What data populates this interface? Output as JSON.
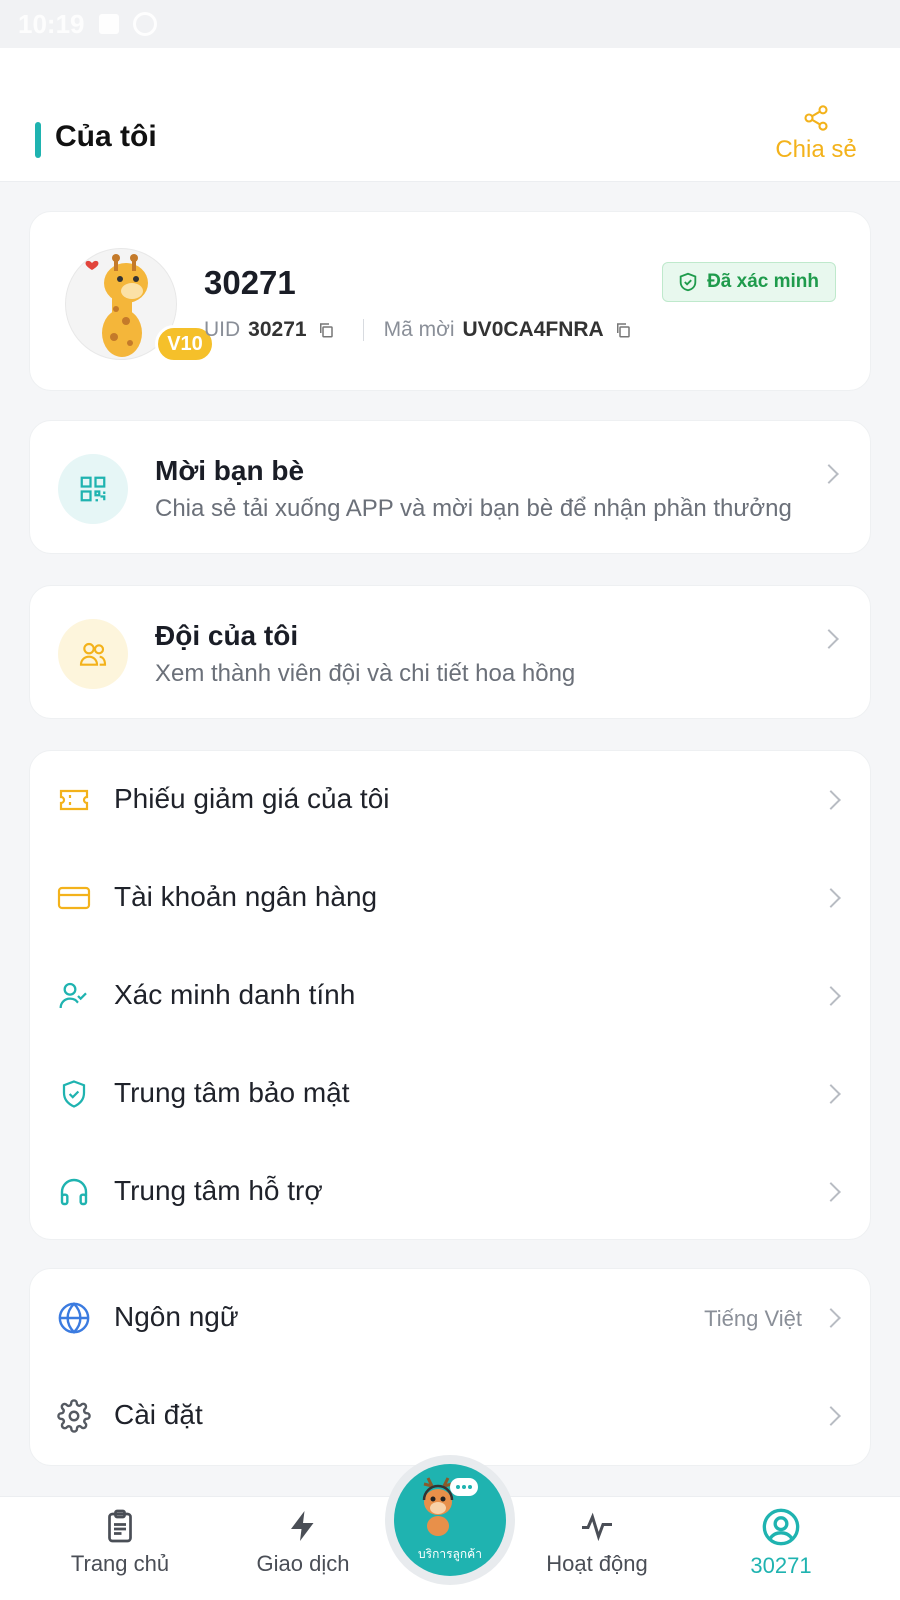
{
  "status_bar": {
    "time": "10:19"
  },
  "header": {
    "title": "Của tôi",
    "share_label": "Chia sẻ"
  },
  "profile": {
    "username": "30271",
    "level": "V10",
    "verified_label": "Đã xác minh",
    "uid_label": "UID",
    "uid_value": "30271",
    "invite_label": "Mã mời",
    "invite_code": "UV0CA4FNRA"
  },
  "invite_card": {
    "title": "Mời bạn bè",
    "subtitle": "Chia sẻ tải xuống APP và mời bạn bè để nhận phần thưởng"
  },
  "team_card": {
    "title": "Đội của tôi",
    "subtitle": "Xem thành viên đội và chi tiết hoa hồng"
  },
  "menu": [
    {
      "label": "Phiếu giảm giá của tôi",
      "icon": "ticket-icon"
    },
    {
      "label": "Tài khoản ngân hàng",
      "icon": "credit-card-icon"
    },
    {
      "label": "Xác minh danh tính",
      "icon": "user-check-icon"
    },
    {
      "label": "Trung tâm bảo mật",
      "icon": "shield-icon"
    },
    {
      "label": "Trung tâm hỗ trợ",
      "icon": "headphones-icon"
    }
  ],
  "settings": [
    {
      "label": "Ngôn ngữ",
      "value": "Tiếng Việt",
      "icon": "globe-icon"
    },
    {
      "label": "Cài đặt",
      "icon": "gear-icon"
    }
  ],
  "bottom_nav": {
    "home": "Trang chủ",
    "trade": "Giao dịch",
    "center_label": "บริการลูกค้า",
    "activity": "Hoạt động",
    "profile": "30271"
  },
  "colors": {
    "accent": "#1fb3b0",
    "yellow": "#f3b21b",
    "verified": "#1f9b4c"
  }
}
